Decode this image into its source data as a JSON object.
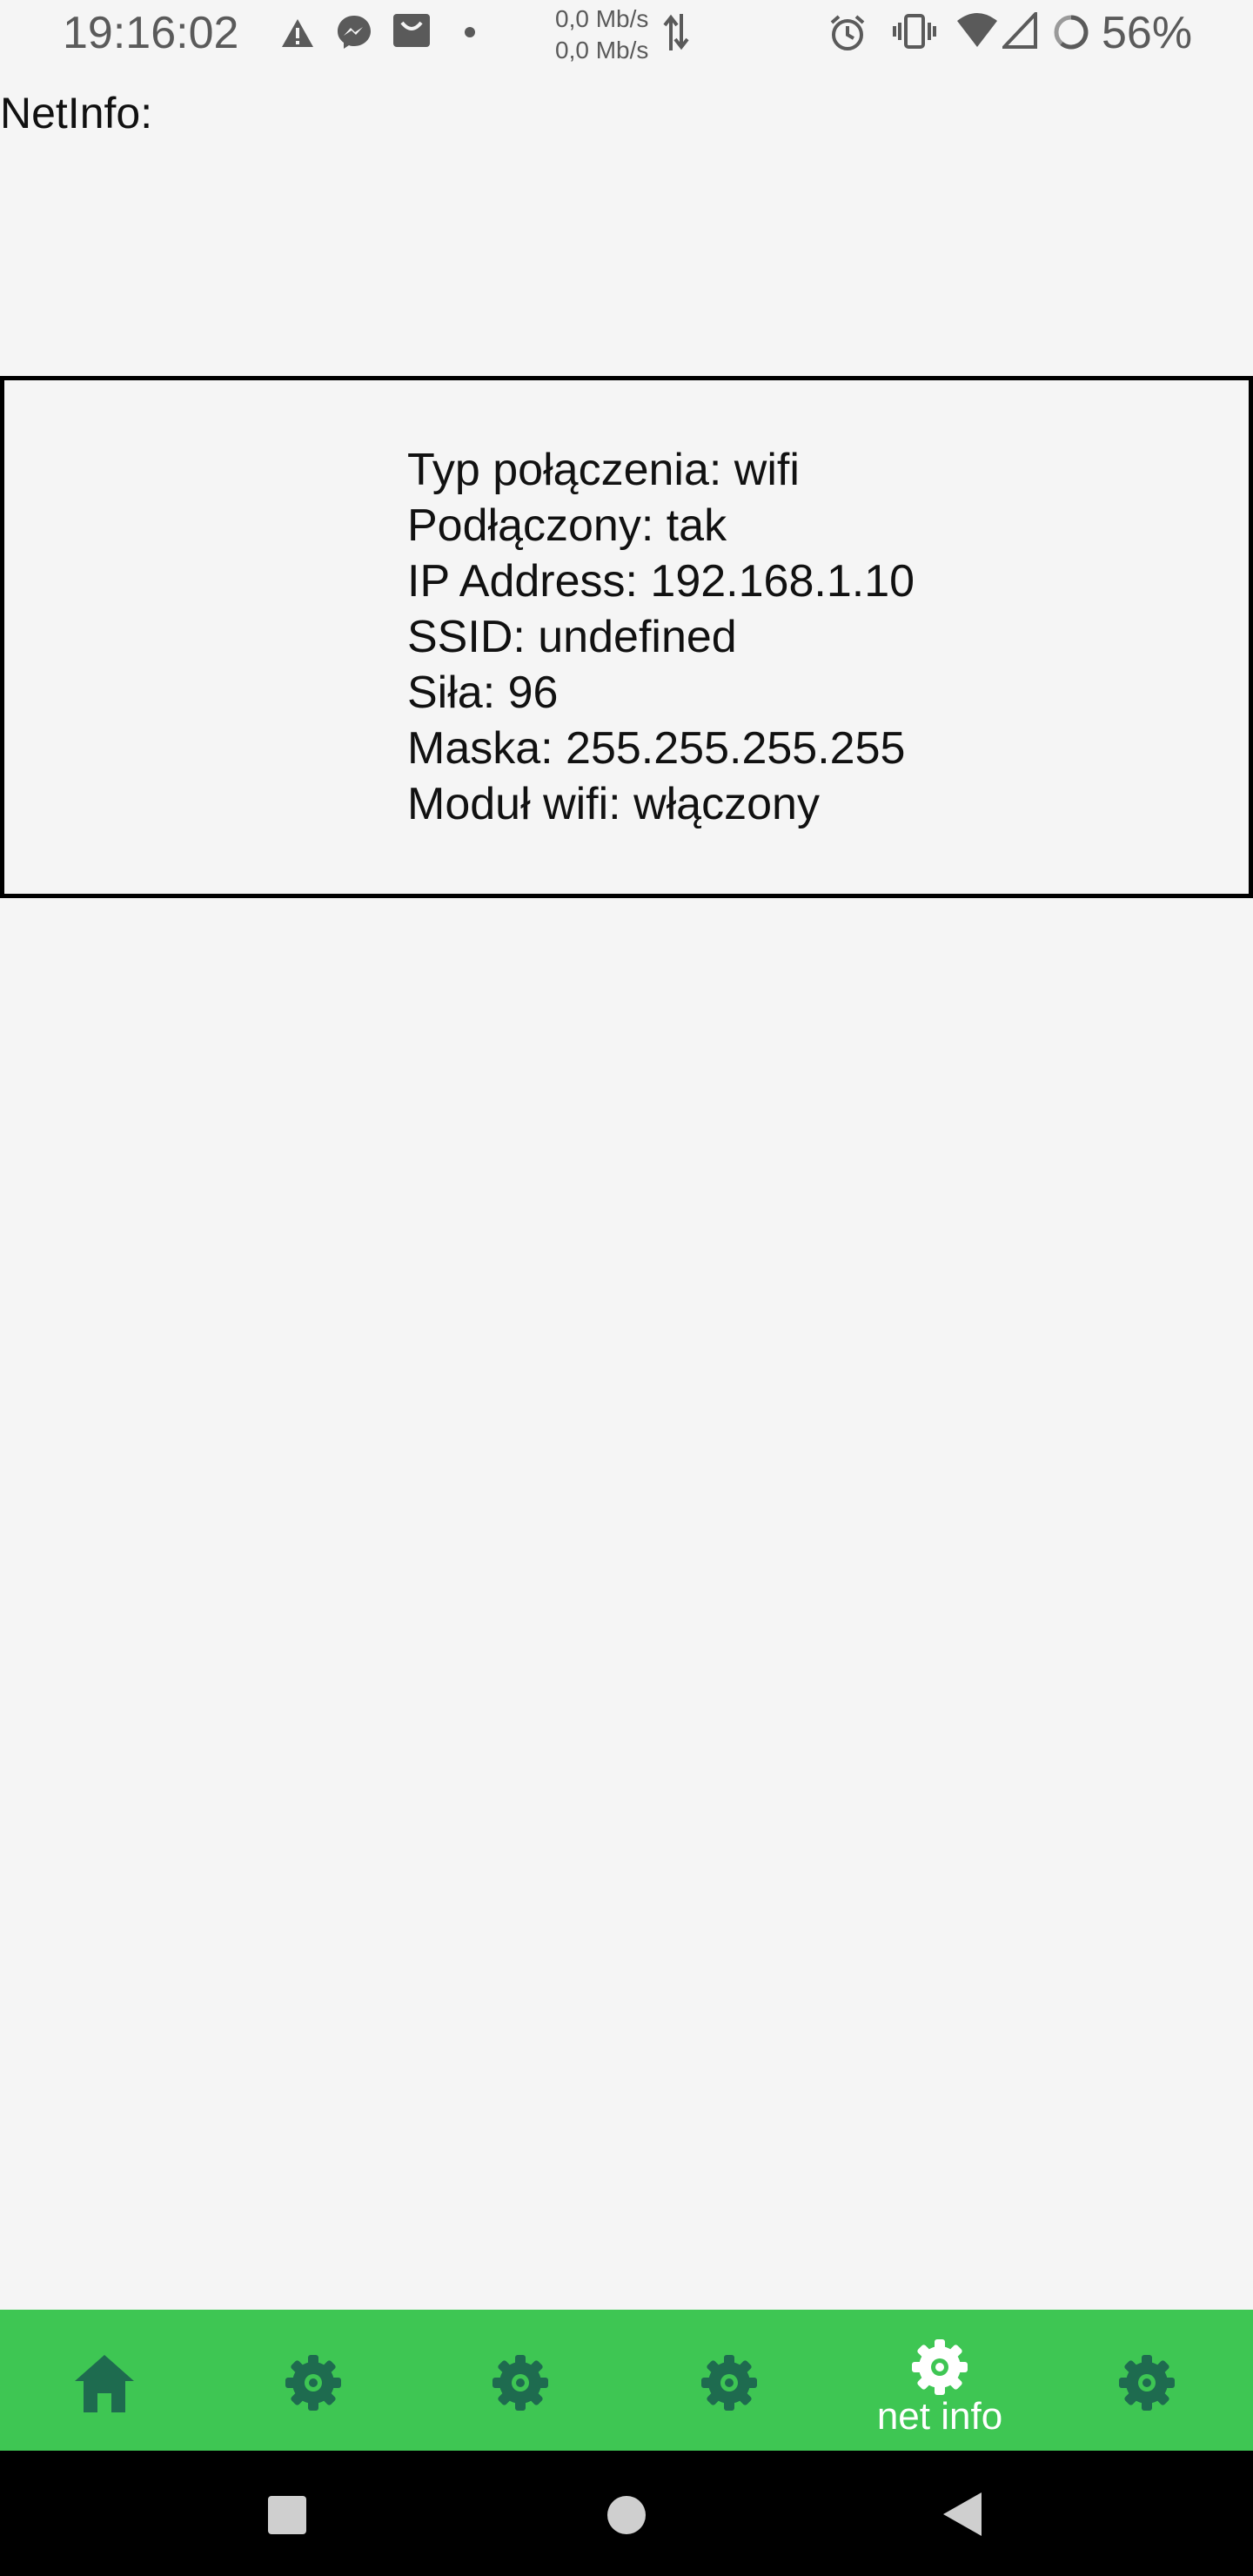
{
  "status_bar": {
    "time": "19:16:02",
    "net_up": "0,0 Mb/s",
    "net_down": "0,0 Mb/s",
    "battery": "56%",
    "icons": [
      "warning-icon",
      "messenger-icon",
      "shop-bag-icon",
      "dot-icon",
      "data-arrows-icon",
      "alarm-icon",
      "vibrate-icon",
      "wifi-icon",
      "signal-icon",
      "battery-ring-icon"
    ]
  },
  "page": {
    "title": "NetInfo:"
  },
  "info": {
    "type": "Typ połączenia: wifi",
    "connected": "Podłączony: tak",
    "ip": "IP Address: 192.168.1.10",
    "ssid": "SSID: undefined",
    "strength": "Siła: 96",
    "mask": "Maska: 255.255.255.255",
    "wifi_module": "Moduł wifi: włączony"
  },
  "tabs": [
    {
      "icon": "home-icon",
      "label": ""
    },
    {
      "icon": "gear-icon",
      "label": ""
    },
    {
      "icon": "gear-icon",
      "label": ""
    },
    {
      "icon": "gear-icon",
      "label": ""
    },
    {
      "icon": "gear-icon",
      "label": "net info",
      "active": true
    },
    {
      "icon": "gear-icon",
      "label": ""
    }
  ],
  "colors": {
    "tab_bar": "#3ec653",
    "tab_icon_inactive": "#1e6b4f",
    "tab_active": "#ffffff",
    "background": "#f5f5f5"
  }
}
